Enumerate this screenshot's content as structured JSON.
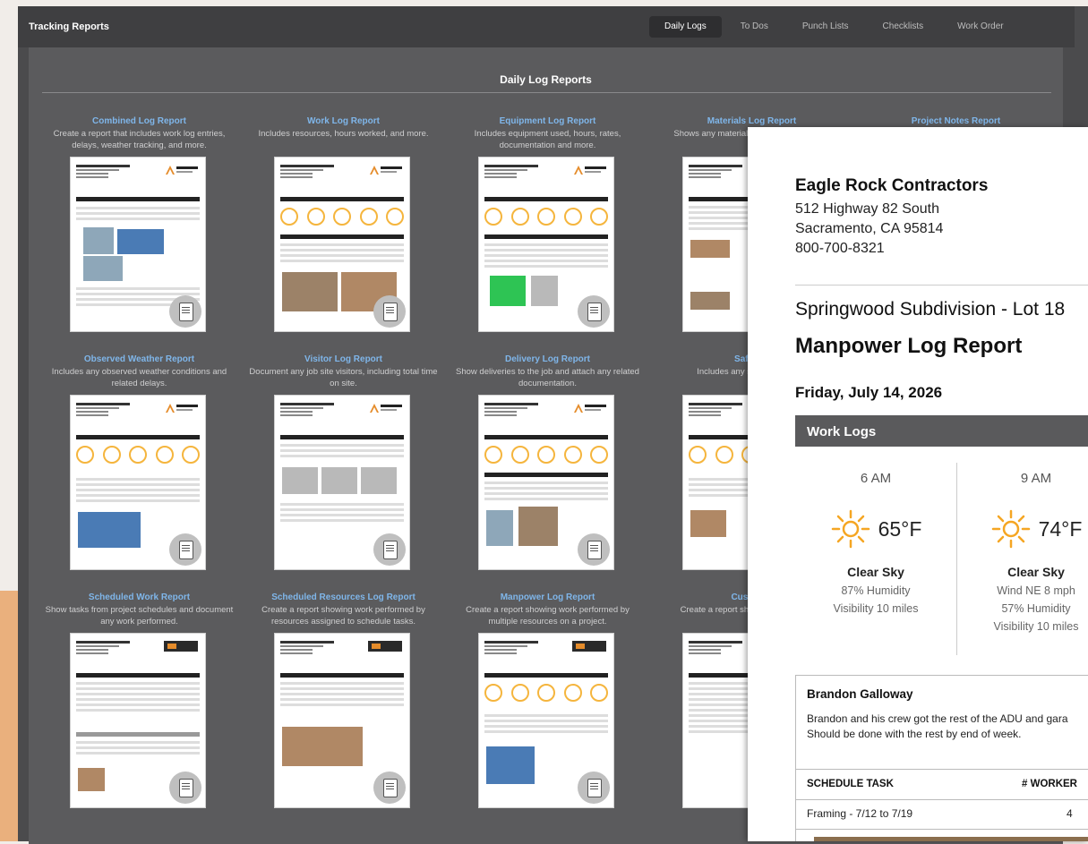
{
  "app": {
    "title": "Tracking Reports"
  },
  "tabs": [
    {
      "label": "Daily Logs",
      "active": true
    },
    {
      "label": "To Dos"
    },
    {
      "label": "Punch Lists"
    },
    {
      "label": "Checklists"
    },
    {
      "label": "Work Order"
    }
  ],
  "panel": {
    "title": "Daily Log Reports"
  },
  "reports": [
    {
      "title": "Combined Log Report",
      "desc": "Create a report that includes work log entries, delays, weather tracking, and more."
    },
    {
      "title": "Work Log Report",
      "desc": "Includes resources, hours worked, and more."
    },
    {
      "title": "Equipment Log Report",
      "desc": "Includes equipment used, hours, rates, documentation and more."
    },
    {
      "title": "Materials Log Report",
      "desc": "Shows any materials quantities, costs, att"
    },
    {
      "title": "Project Notes Report",
      "desc": ""
    },
    {
      "title": "Observed Weather Report",
      "desc": "Includes any observed weather conditions and related delays."
    },
    {
      "title": "Visitor Log Report",
      "desc": "Document any job site visitors, including total time on site."
    },
    {
      "title": "Delivery Log Report",
      "desc": "Show deliveries to the job and attach any related documentation."
    },
    {
      "title": "Safety L",
      "desc": "Includes any safety meetings"
    },
    {
      "title": "Scheduled Work Report",
      "desc": "Show tasks from project schedules and document any work performed."
    },
    {
      "title": "Scheduled Resources Log Report",
      "desc": "Create a report showing work performed by resources assigned to schedule tasks."
    },
    {
      "title": "Manpower Log Report",
      "desc": "Create a report showing work performed by multiple resources on a project."
    },
    {
      "title": "Custom L",
      "desc": "Create a report showi your company's"
    }
  ],
  "preview": {
    "company": "Eagle Rock Contractors",
    "address1": "512 Highway 82 South",
    "address2": "Sacramento, CA 95814",
    "phone": "800-700-8321",
    "project": "Springwood Subdivision - Lot 18",
    "report_title": "Manpower Log Report",
    "date": "Friday, July 14, 2026",
    "section": "Work Logs",
    "weather": [
      {
        "time": "6 AM",
        "temp": "65°F",
        "condition": "Clear Sky",
        "line1": "87% Humidity",
        "line2": "Visibility 10 miles",
        "icon": "sun-icon"
      },
      {
        "time": "9 AM",
        "temp": "74°F",
        "condition": "Clear Sky",
        "line1": "Wind NE 8 mph",
        "line2": "57% Humidity",
        "line3": "Visibility 10 miles",
        "icon": "sun-icon"
      }
    ],
    "entry": {
      "name": "Brandon Galloway",
      "note1": "Brandon and his crew got the rest of the ADU and gara",
      "note2": "Should be done with the rest by end of week.",
      "col_task": "SCHEDULE TASK",
      "col_workers": "# WORKER",
      "row_task": "Framing - 7/12 to 7/19",
      "row_workers": "4"
    }
  },
  "colors": {
    "accent_link": "#7fb6ea",
    "sun": "#f5a623",
    "brand_orange": "#e58c2b"
  }
}
